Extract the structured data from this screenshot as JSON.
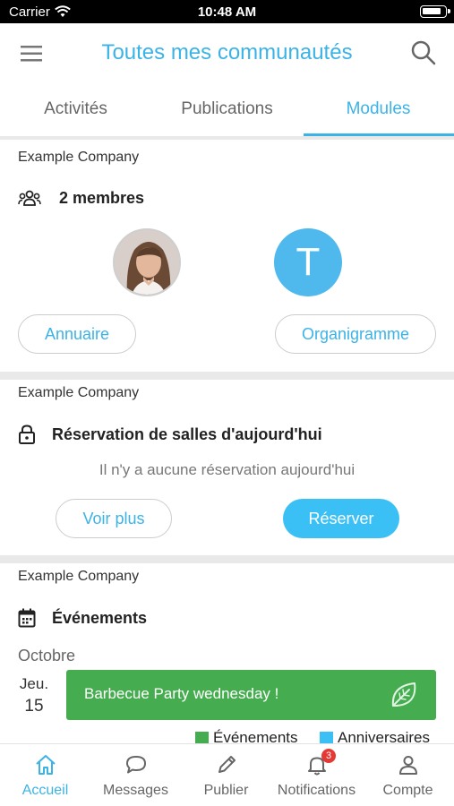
{
  "status_bar": {
    "carrier": "Carrier",
    "time": "10:48 AM"
  },
  "header": {
    "title": "Toutes mes communautés"
  },
  "tabs": [
    {
      "label": "Activités",
      "active": false
    },
    {
      "label": "Publications",
      "active": false
    },
    {
      "label": "Modules",
      "active": true
    }
  ],
  "members_card": {
    "company": "Example Company",
    "title": "2 membres",
    "avatar_letter": "T",
    "buttons": {
      "left": "Annuaire",
      "right": "Organigramme"
    }
  },
  "rooms_card": {
    "company": "Example Company",
    "title": "Réservation de salles d'aujourd'hui",
    "empty_message": "Il n'y a aucune réservation aujourd'hui",
    "buttons": {
      "left": "Voir plus",
      "right": "Réserver"
    }
  },
  "events_card": {
    "company": "Example Company",
    "title": "Événements",
    "month": "Octobre",
    "day_name": "Jeu.",
    "day_number": "15",
    "event_title": "Barbecue Party wednesday !",
    "legend": [
      {
        "label": "Événements",
        "color": "#45ad4f"
      },
      {
        "label": "Anniversaires",
        "color": "#3bc0f5"
      }
    ]
  },
  "bottom_nav": [
    {
      "label": "Accueil",
      "icon": "home-icon",
      "active": true
    },
    {
      "label": "Messages",
      "icon": "chat-bubble-icon",
      "active": false
    },
    {
      "label": "Publier",
      "icon": "pencil-icon",
      "active": false
    },
    {
      "label": "Notifications",
      "icon": "bell-icon",
      "active": false,
      "badge": "3"
    },
    {
      "label": "Compte",
      "icon": "user-icon",
      "active": false
    }
  ],
  "colors": {
    "accent": "#3bb3e6",
    "button_fill": "#3bc0f5",
    "event_green": "#45ad4f",
    "badge_red": "#e53935"
  }
}
